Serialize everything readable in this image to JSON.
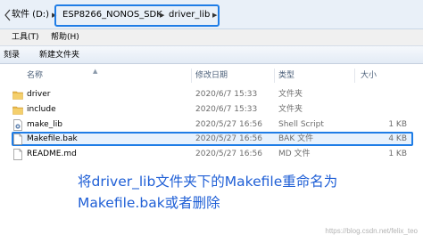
{
  "address": {
    "crumbs": [
      "软件 (D:)",
      "ESP8266_NONOS_SDK",
      "driver_lib"
    ]
  },
  "menu": {
    "tools": "工具(T)",
    "help": "帮助(H)"
  },
  "toolbar": {
    "burn": "刻录",
    "new_folder": "新建文件夹"
  },
  "columns": {
    "name": "名称",
    "date": "修改日期",
    "type": "类型",
    "size": "大小"
  },
  "files": [
    {
      "name": "driver",
      "date": "2020/6/7 15:33",
      "type": "文件夹",
      "size": "",
      "icon": "folder-icon"
    },
    {
      "name": "include",
      "date": "2020/6/7 15:33",
      "type": "文件夹",
      "size": "",
      "icon": "folder-icon"
    },
    {
      "name": "make_lib",
      "date": "2020/5/27 16:56",
      "type": "Shell Script",
      "size": "1 KB",
      "icon": "script-icon"
    },
    {
      "name": "Makefile.bak",
      "date": "2020/5/27 16:56",
      "type": "BAK 文件",
      "size": "4 KB",
      "icon": "file-icon"
    },
    {
      "name": "README.md",
      "date": "2020/5/27 16:56",
      "type": "MD 文件",
      "size": "1 KB",
      "icon": "file-icon"
    }
  ],
  "annotation": {
    "line1": "将driver_lib文件夹下的Makefile重命名为",
    "line2": "Makefile.bak或者删除"
  },
  "watermark": "https://blog.csdn.net/felix_teo",
  "colors": {
    "highlight": "#1f7de6",
    "annotation": "#1f5fd6",
    "folder": "#e9b84a"
  }
}
